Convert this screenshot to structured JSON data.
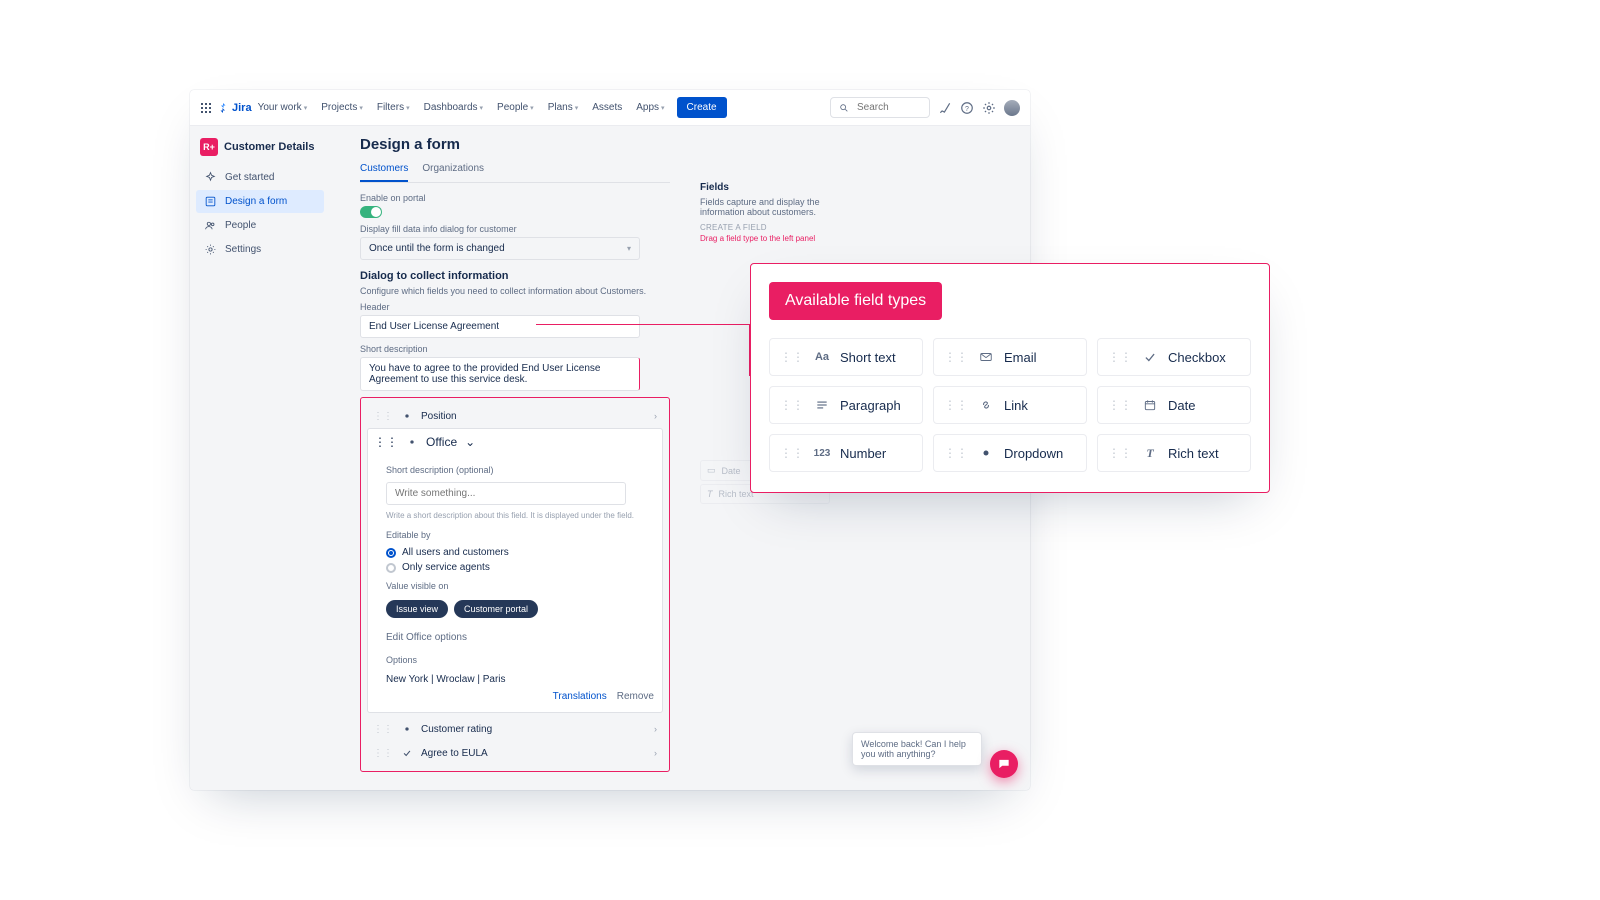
{
  "nav": {
    "brand": "Jira",
    "items": [
      "Your work",
      "Projects",
      "Filters",
      "Dashboards",
      "People",
      "Plans",
      "Assets",
      "Apps"
    ],
    "items_nochev": [
      "Assets"
    ],
    "create": "Create",
    "search_placeholder": "Search"
  },
  "workspace": {
    "abbr": "R+",
    "name": "Customer Details"
  },
  "sidebar": {
    "items": [
      {
        "icon": "sparkle",
        "label": "Get started"
      },
      {
        "icon": "form",
        "label": "Design a form",
        "active": true
      },
      {
        "icon": "people",
        "label": "People"
      },
      {
        "icon": "gear",
        "label": "Settings"
      }
    ]
  },
  "page": {
    "title": "Design a form",
    "tabs": [
      {
        "label": "Customers",
        "active": true
      },
      {
        "label": "Organizations"
      }
    ],
    "enable_label": "Enable on portal",
    "display_label": "Display fill data info dialog for customer",
    "display_value": "Once until the form is changed",
    "dialog_title": "Dialog to collect information",
    "dialog_help": "Configure which fields you need to collect information about Customers.",
    "header_label": "Header",
    "header_value": "End User License Agreement",
    "short_label": "Short description",
    "short_value": "You have to agree to the provided End User License Agreement to use this service desk."
  },
  "form_fields": {
    "item0": {
      "type": "dropdown",
      "label": "Position"
    },
    "item1": {
      "type": "dropdown",
      "label": "Office",
      "open": true
    },
    "open_body": {
      "sd_label": "Short description (optional)",
      "sd_placeholder": "Write something...",
      "sd_hint": "Write a short description about this field. It is displayed under the field.",
      "editable_label": "Editable by",
      "editable_opt1": "All users and customers",
      "editable_opt2": "Only service agents",
      "visible_label": "Value visible on",
      "pill1": "Issue view",
      "pill2": "Customer portal",
      "edit_options": "Edit Office options",
      "options_label": "Options",
      "options_value": "New York | Wroclaw | Paris",
      "act_translations": "Translations",
      "act_remove": "Remove"
    },
    "item2": {
      "type": "dropdown",
      "label": "Customer rating"
    },
    "item3": {
      "type": "checkbox",
      "label": "Agree to EULA"
    }
  },
  "fields_panel": {
    "title": "Fields",
    "desc": "Fields capture and display the information about customers.",
    "create_label": "CREATE A FIELD",
    "hint": "Drag a field type to the left panel",
    "dim_items": [
      {
        "icon": "date",
        "label": "Date"
      },
      {
        "icon": "richtext",
        "label": "Rich text"
      }
    ]
  },
  "chat": {
    "message": "Welcome back! Can I help you with anything?"
  },
  "callout": {
    "title": "Available field types",
    "types": [
      {
        "icon": "Aa",
        "label": "Short text",
        "name": "short-text"
      },
      {
        "icon": "mail",
        "label": "Email",
        "name": "email"
      },
      {
        "icon": "check",
        "label": "Checkbox",
        "name": "checkbox"
      },
      {
        "icon": "para",
        "label": "Paragraph",
        "name": "paragraph"
      },
      {
        "icon": "link",
        "label": "Link",
        "name": "link"
      },
      {
        "icon": "date",
        "label": "Date",
        "name": "date"
      },
      {
        "icon": "123",
        "label": "Number",
        "name": "number"
      },
      {
        "icon": "dd",
        "label": "Dropdown",
        "name": "dropdown"
      },
      {
        "icon": "rt",
        "label": "Rich text",
        "name": "rich-text"
      }
    ]
  },
  "colors": {
    "accent": "#E91E63",
    "primary": "#0052CC",
    "green": "#36B37E"
  }
}
